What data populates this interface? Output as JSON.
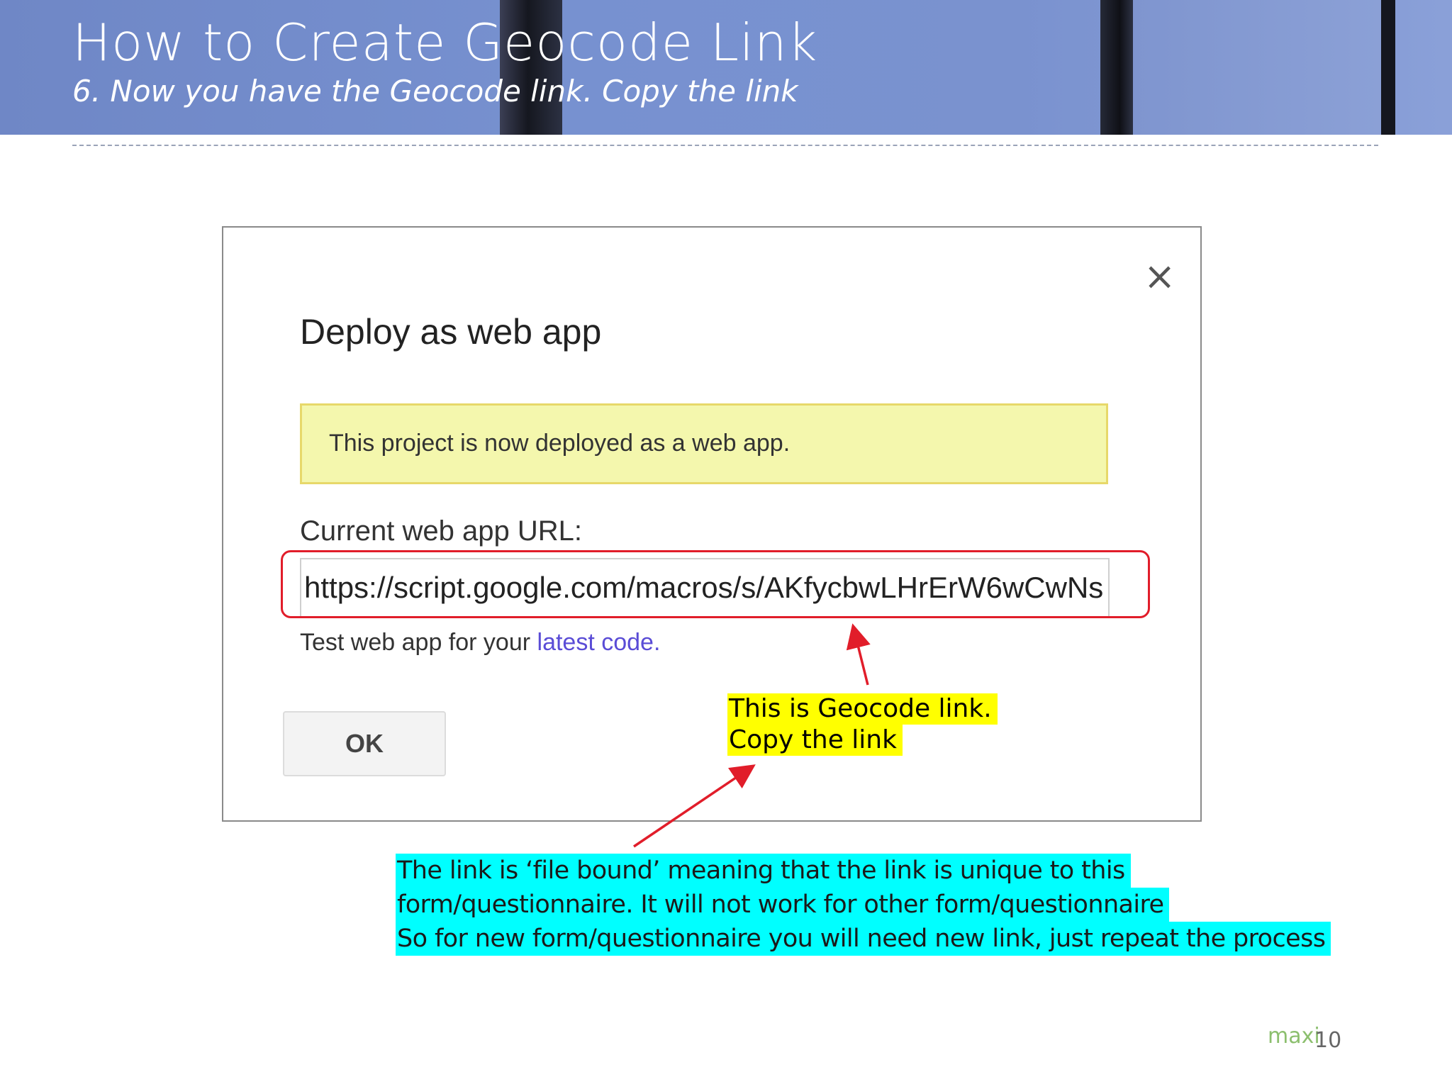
{
  "slide": {
    "title": "How to Create Geocode Link",
    "subtitle": "6. Now you have the Geocode link. Copy the link",
    "page_number": "10",
    "logo_text": "maxi"
  },
  "dialog": {
    "close_icon": "×",
    "title": "Deploy as web app",
    "notice": "This project is now deployed as a web app.",
    "url_label": "Current web app URL:",
    "url_value": "https://script.google.com/macros/s/AKfycbwLHrErW6wCwNs",
    "test_prefix": "Test web app for your ",
    "test_link": "latest code.",
    "ok_label": "OK"
  },
  "callouts": {
    "yellow": [
      "This is Geocode link.",
      "Copy the link"
    ],
    "cyan": [
      "The link is ‘file bound’ meaning that the link is unique to this",
      "form/questionnaire. It will not work for other form/questionnaire",
      "So for new form/questionnaire  you will need new link, just repeat the process"
    ]
  },
  "colors": {
    "banner": "#7791d0",
    "highlight_red": "#e11d2a",
    "callout_yellow": "#ffff00",
    "callout_cyan": "#00ffff",
    "notice_bg": "#f4f7ad",
    "link": "#5a4cd6"
  }
}
